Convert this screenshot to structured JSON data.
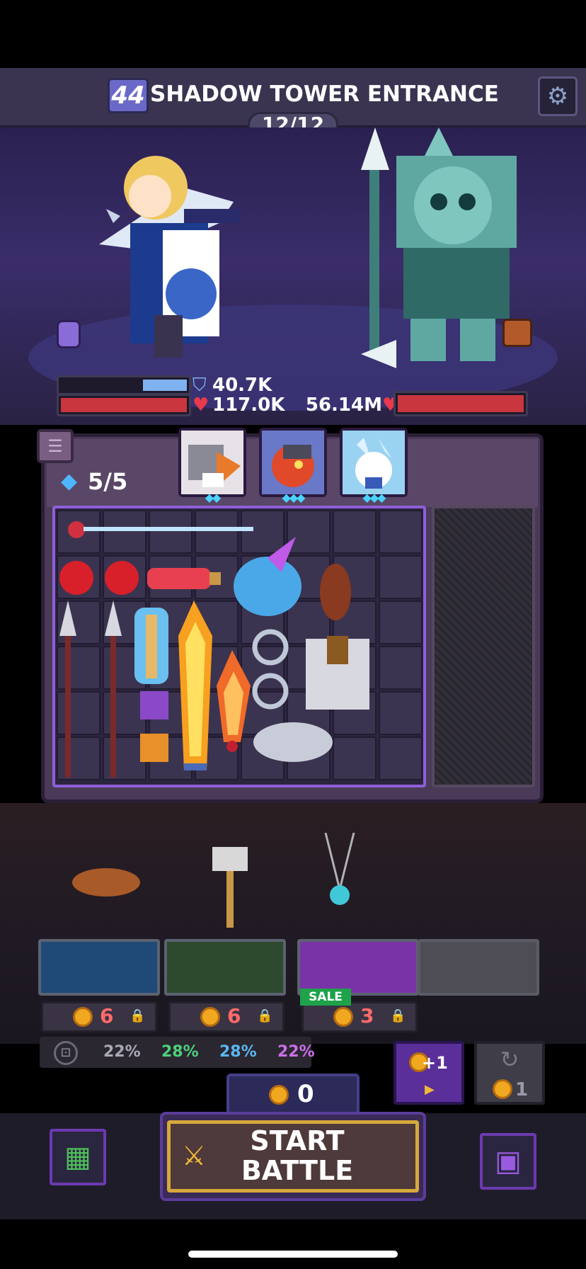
{
  "header": {
    "level": "44",
    "title": "SHADOW TOWER ENTRANCE",
    "wave": "12/12",
    "settings_icon": "gear-icon"
  },
  "battle": {
    "hero": {
      "shield": "40.7K",
      "hp": "117.0K",
      "shield_ratio": 0.35,
      "hp_ratio": 1.0
    },
    "enemy": {
      "hp": "56.14M",
      "hp_ratio": 1.0
    }
  },
  "bag": {
    "energy": "5/5",
    "hero_cards": [
      {
        "name": "cat-knight",
        "gems": "◆◆"
      },
      {
        "name": "dragon",
        "gems": "◆◆◆"
      },
      {
        "name": "wolf",
        "gems": "◆◆◆"
      }
    ]
  },
  "shop": {
    "slots": [
      {
        "color": "#1f4a78",
        "price": "6"
      },
      {
        "color": "#2d4a2e",
        "price": "6"
      },
      {
        "color": "#7a33a6",
        "price": "3",
        "tag": "SALE"
      }
    ],
    "odds": [
      "22%",
      "28%",
      "28%",
      "22%"
    ],
    "reroll_label": "+1",
    "refresh_cost": "1"
  },
  "gold": "0",
  "start_button": {
    "label_line1": "START",
    "label_line2": "BATTLE"
  }
}
